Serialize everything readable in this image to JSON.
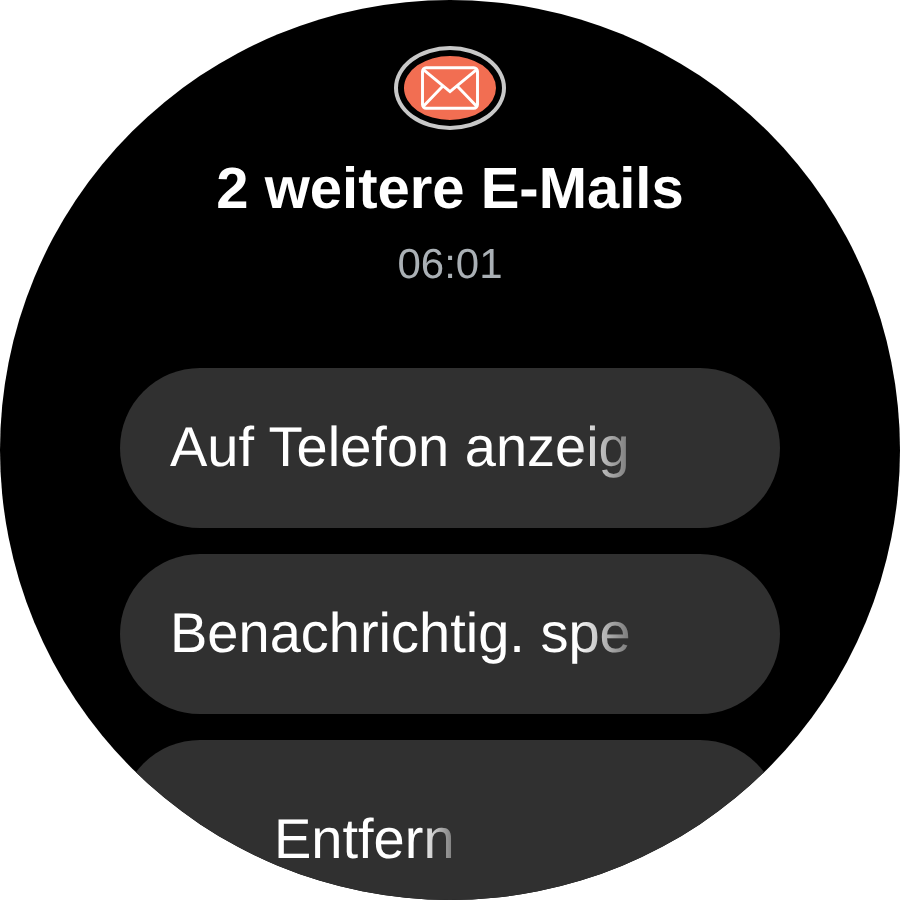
{
  "notification": {
    "title": "2 weitere E-Mails",
    "time": "06:01"
  },
  "actions": [
    {
      "label": "Auf Telefon anzeig"
    },
    {
      "label": "Benachrichtig. spe"
    },
    {
      "label": "Entfern"
    }
  ]
}
